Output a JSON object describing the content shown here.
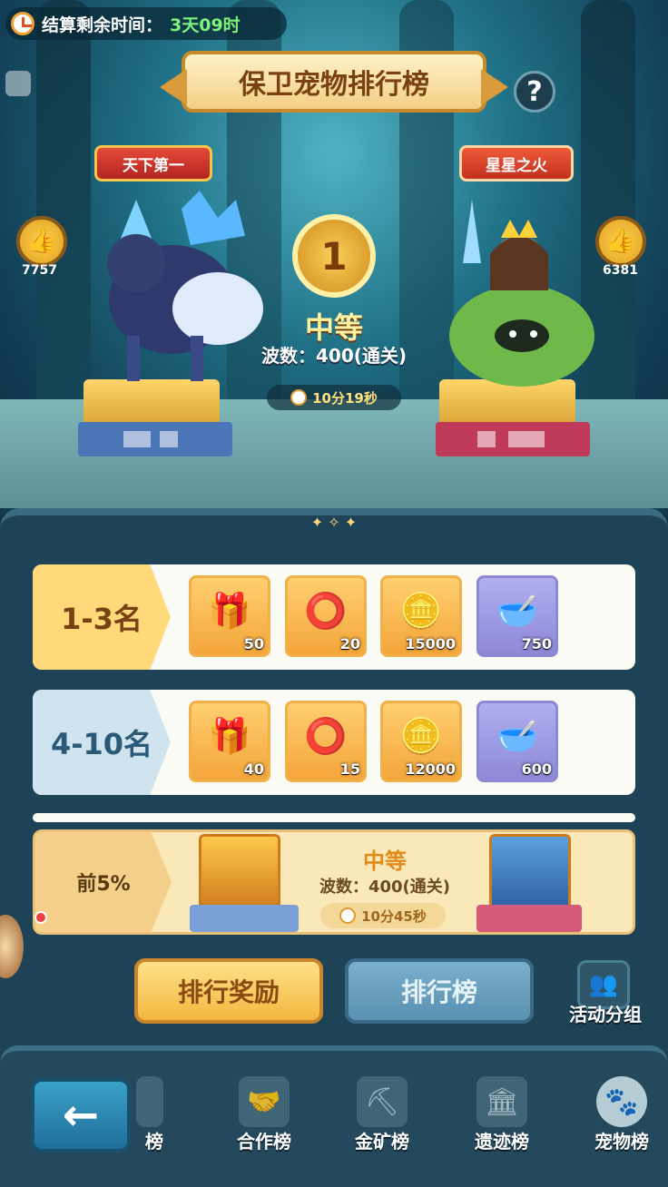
{
  "timer": {
    "label": "结算剩余时间：",
    "value": "3天09时"
  },
  "title": "保卫宠物排行榜",
  "help": "?",
  "podium": {
    "left": {
      "ribbon": "天下第一",
      "likes": "7757"
    },
    "right": {
      "ribbon": "星星之火",
      "likes": "6381"
    }
  },
  "center": {
    "rank": "1",
    "grade": "中等",
    "wave": "波数：400(通关)",
    "time": "10分19秒"
  },
  "rewards": [
    {
      "label": "1-3名",
      "items": [
        {
          "icon": "treasure-chest-icon",
          "count": "50"
        },
        {
          "icon": "pet-collar-icon",
          "count": "20"
        },
        {
          "icon": "pet-coin-icon",
          "count": "15000"
        },
        {
          "icon": "pet-food-bowl-icon",
          "count": "750"
        }
      ]
    },
    {
      "label": "4-10名",
      "items": [
        {
          "icon": "treasure-chest-icon",
          "count": "40"
        },
        {
          "icon": "pet-collar-icon",
          "count": "15"
        },
        {
          "icon": "pet-coin-icon",
          "count": "12000"
        },
        {
          "icon": "pet-food-bowl-icon",
          "count": "600"
        }
      ]
    }
  ],
  "my_rank": {
    "label": "前5%",
    "grade": "中等",
    "wave": "波数：400(通关)",
    "time": "10分45秒"
  },
  "buttons": {
    "reward": "排行奖励",
    "rank": "排行榜",
    "group": "活动分组"
  },
  "nav": {
    "back": "←",
    "items": [
      {
        "label": "榜"
      },
      {
        "label": "合作榜"
      },
      {
        "label": "金矿榜"
      },
      {
        "label": "遗迹榜"
      },
      {
        "label": "宠物榜"
      }
    ]
  },
  "colors": {
    "accent_gold": "#f3b83e",
    "panel": "#1e4356",
    "timer_green": "#7ff27a"
  }
}
